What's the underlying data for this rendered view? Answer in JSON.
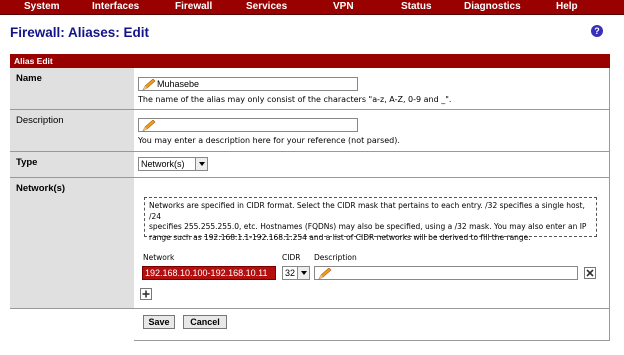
{
  "menu": [
    "System",
    "Interfaces",
    "Firewall",
    "Services",
    "VPN",
    "Status",
    "Diagnostics",
    "Help"
  ],
  "page_title": "Firewall: Aliases: Edit",
  "help_glyph": "?",
  "section_header": "Alias Edit",
  "name": {
    "label": "Name",
    "value": "Muhasebe",
    "note": "The name of the alias may only consist of the characters \"a-z, A-Z, 0-9 and _\"."
  },
  "description": {
    "label": "Description",
    "value": "",
    "note": "You may enter a description here for your reference (not parsed)."
  },
  "type": {
    "label": "Type",
    "selected": "Network(s)"
  },
  "networks": {
    "label": "Network(s)",
    "info_lines": [
      "Networks are specified in CIDR format. Select the CIDR mask that pertains to each entry. /32 specifies a single host, /24",
      "specifies 255.255.255.0, etc. Hostnames (FQDNs) may also be specified, using a /32 mask. You may also enter an IP",
      "range such as 192.168.1.1-192.168.1.254 and a list of CIDR networks will be derived to fill the range."
    ],
    "col_network": "Network",
    "col_cidr": "CIDR",
    "col_description": "Description",
    "row": {
      "network": "192.168.10.100-192.168.10.11",
      "cidr": "32",
      "description": ""
    }
  },
  "buttons": {
    "save": "Save",
    "cancel": "Cancel"
  }
}
